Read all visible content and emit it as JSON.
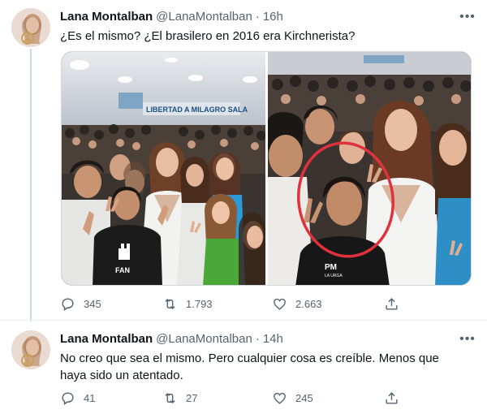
{
  "tweets": [
    {
      "author_name": "Lana Montalban",
      "handle": "@LanaMontalban",
      "separator": "·",
      "time": "16h",
      "text": "¿Es el mismo? ¿El brasilero en 2016 era Kirchnerista?",
      "media": {
        "left_banner": "LIBERTAD A MILAGRO SALA",
        "left_badge": "FAN",
        "right_badge_line1": "PM",
        "right_badge_line2": "LA URGA"
      },
      "replies": "345",
      "retweets": "1.793",
      "likes": "2.663"
    },
    {
      "author_name": "Lana Montalban",
      "handle": "@LanaMontalban",
      "separator": "·",
      "time": "14h",
      "text": "No creo que sea el mismo. Pero cualquier cosa es creíble. Menos que haya sido un atentado.",
      "replies": "41",
      "retweets": "27",
      "likes": "245"
    }
  ],
  "more_icon": "more-dots",
  "colors": {
    "secondary_text": "#536471",
    "thread_line": "#cfd9de",
    "highlight_circle": "#e0323c"
  }
}
